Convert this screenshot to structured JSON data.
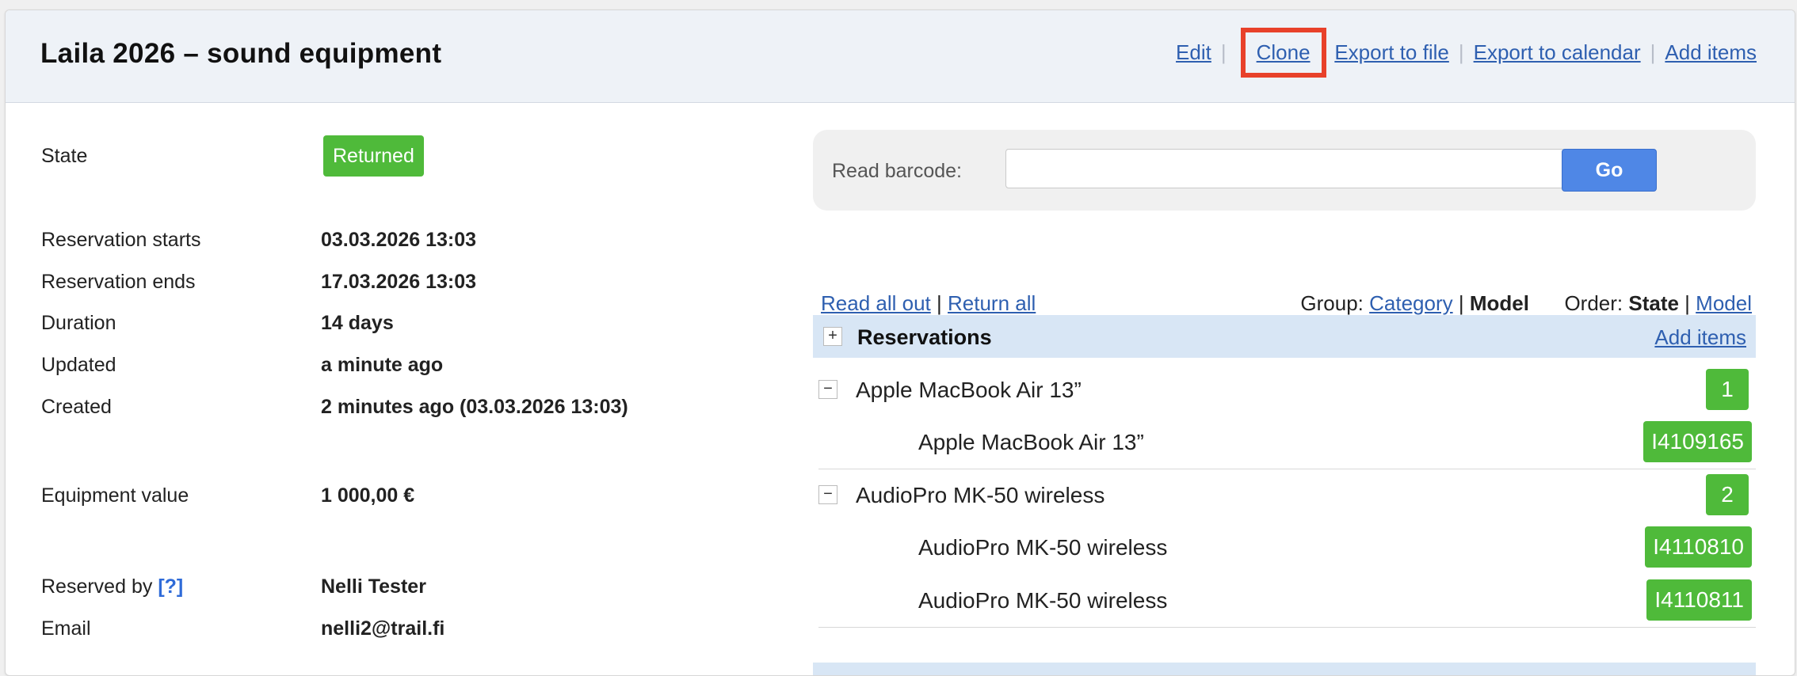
{
  "header": {
    "title": "Laila 2026 – sound equipment",
    "actions": {
      "edit": "Edit",
      "clone": "Clone",
      "export_file": "Export to file",
      "export_calendar": "Export to calendar",
      "add_items": "Add items",
      "separator": "|"
    }
  },
  "details": {
    "state_label": "State",
    "state_value": "Returned",
    "res_starts_label": "Reservation starts",
    "res_starts_value": "03.03.2026 13:03",
    "res_ends_label": "Reservation ends",
    "res_ends_value": "17.03.2026 13:03",
    "duration_label": "Duration",
    "duration_value": "14 days",
    "updated_label": "Updated",
    "updated_value": "a minute ago",
    "created_label": "Created",
    "created_value": "2 minutes ago (03.03.2026 13:03)",
    "equipment_value_label": "Equipment value",
    "equipment_value_value": "1 000,00 €",
    "reserved_by_label": "Reserved by",
    "reserved_by_help": "[?]",
    "reserved_by_value": "Nelli Tester",
    "email_label": "Email",
    "email_value": "nelli2@trail.fi"
  },
  "barcode": {
    "label": "Read barcode:",
    "value": "",
    "go_label": "Go"
  },
  "list_controls": {
    "read_all_out": "Read all out",
    "sep": "|",
    "return_all": "Return all",
    "group_label": "Group:",
    "group_category": "Category",
    "group_model": "Model",
    "order_label": "Order:",
    "order_state": "State",
    "order_model": "Model"
  },
  "reservations": {
    "expand_symbol": "+",
    "collapse_symbol": "−",
    "title": "Reservations",
    "add_items": "Add items",
    "groups": [
      {
        "model": "Apple MacBook Air 13”",
        "count": "1",
        "items": [
          {
            "name": "Apple MacBook Air 13”",
            "code": "I4109165"
          }
        ]
      },
      {
        "model": "AudioPro MK-50 wireless",
        "count": "2",
        "items": [
          {
            "name": "AudioPro MK-50 wireless",
            "code": "I4110810"
          },
          {
            "name": "AudioPro MK-50 wireless",
            "code": "I4110811"
          }
        ]
      }
    ]
  },
  "colors": {
    "status_green": "#4fba3a",
    "link_blue": "#2e5fb0",
    "highlight_red": "#e8412a",
    "go_blue": "#4f87e6"
  }
}
